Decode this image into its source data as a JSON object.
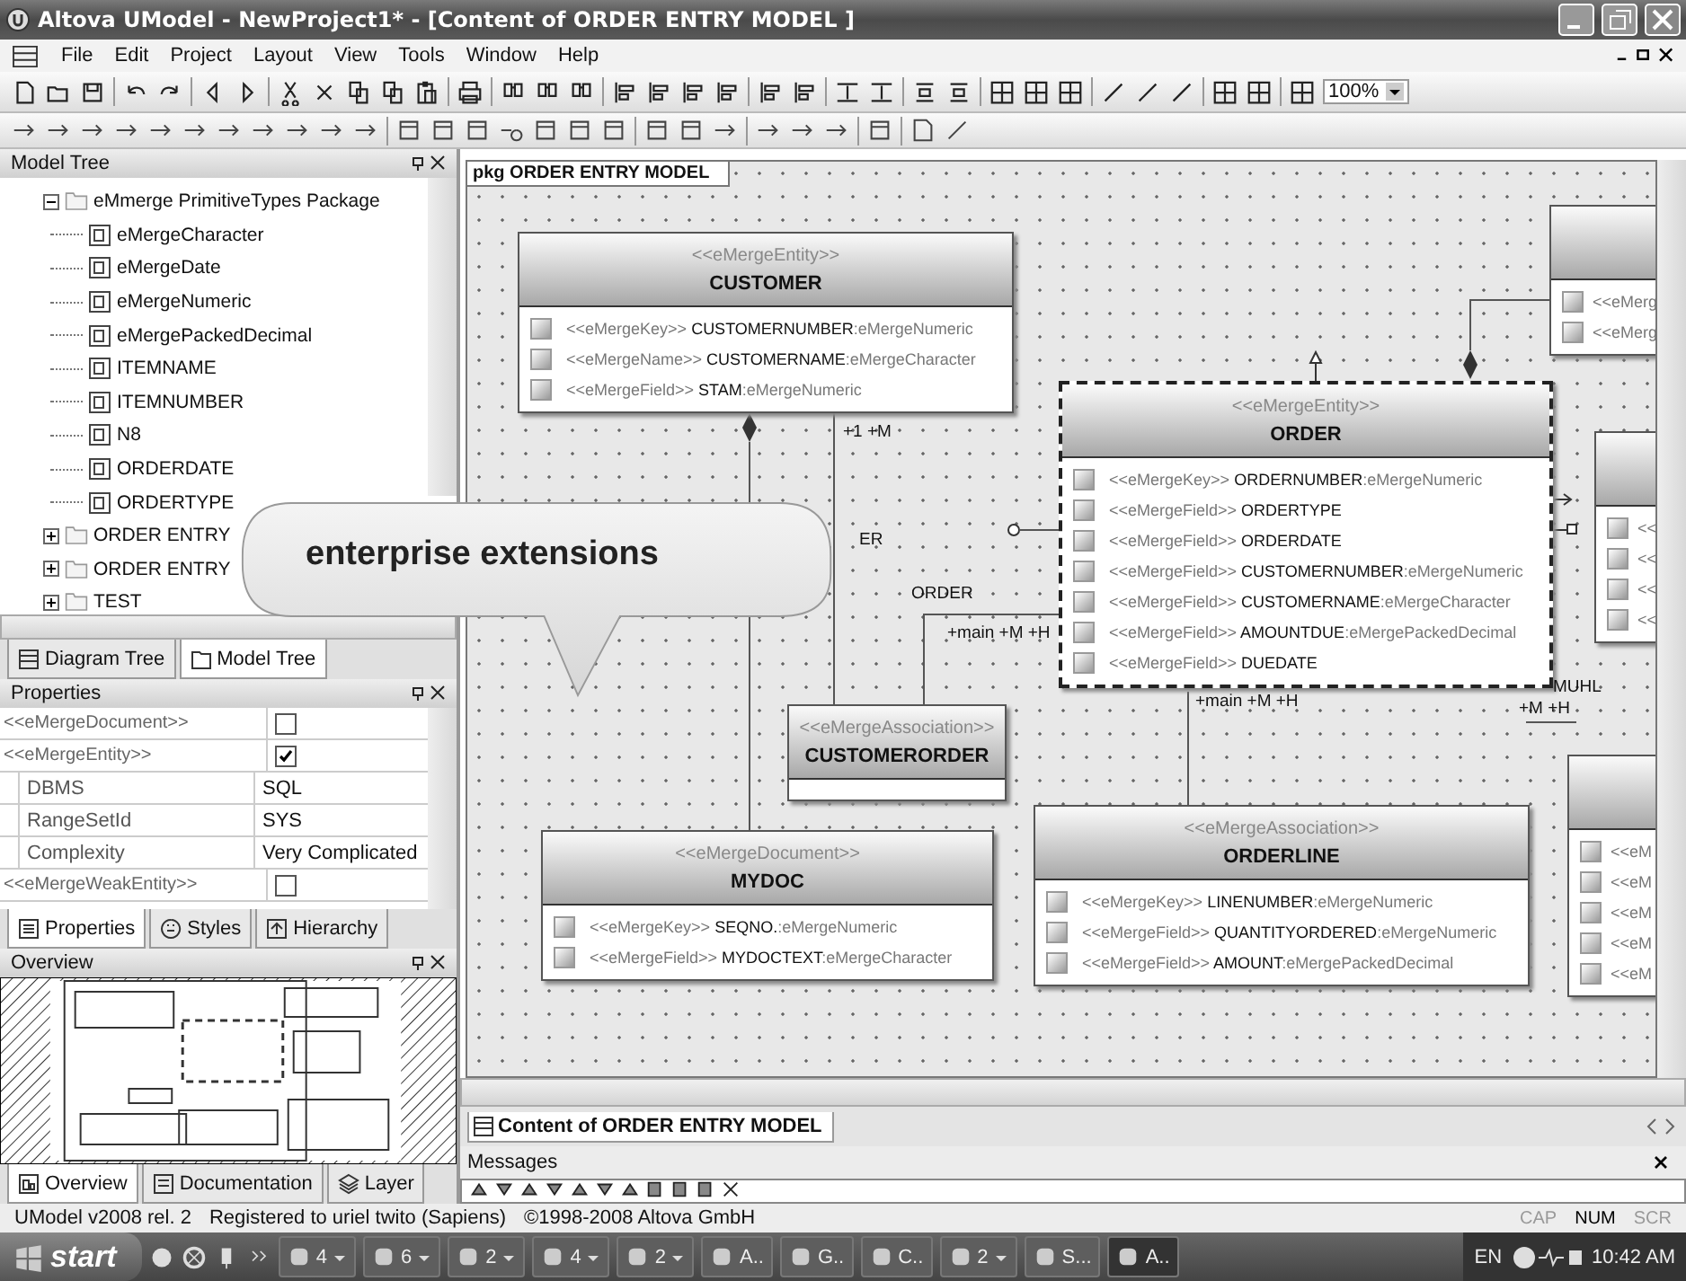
{
  "window": {
    "title": "Altova UModel - NewProject1* - [Content of ORDER ENTRY MODEL ]"
  },
  "menu": [
    "File",
    "Edit",
    "Project",
    "Layout",
    "View",
    "Tools",
    "Window",
    "Help"
  ],
  "toolbar": {
    "zoom": "100%"
  },
  "model_tree": {
    "title": "Model Tree",
    "items": [
      {
        "label": "eMmerge PrimitiveTypes Package",
        "kind": "package",
        "expanded": true,
        "children": [
          {
            "label": "eMergeCharacter",
            "kind": "primitive"
          },
          {
            "label": "eMergeDate",
            "kind": "primitive"
          },
          {
            "label": "eMergeNumeric",
            "kind": "primitive"
          },
          {
            "label": "eMergePackedDecimal",
            "kind": "primitive"
          },
          {
            "label": "ITEMNAME",
            "kind": "primitive"
          },
          {
            "label": "ITEMNUMBER",
            "kind": "primitive"
          },
          {
            "label": "N8",
            "kind": "primitive"
          },
          {
            "label": "ORDERDATE",
            "kind": "primitive"
          },
          {
            "label": "ORDERTYPE",
            "kind": "primitive"
          }
        ]
      },
      {
        "label": "ORDER ENTRY",
        "kind": "package",
        "expanded": false
      },
      {
        "label": "ORDER ENTRY",
        "kind": "package",
        "expanded": false
      },
      {
        "label": "TEST",
        "kind": "package",
        "expanded": false
      }
    ]
  },
  "tree_tabs": [
    {
      "label": "Diagram Tree",
      "selected": false
    },
    {
      "label": "Model Tree",
      "selected": true
    }
  ],
  "properties": {
    "title": "Properties",
    "rows": [
      {
        "name": "<<eMergeDocument>>",
        "kind": "checkbox",
        "checked": false
      },
      {
        "name": "<<eMergeEntity>>",
        "kind": "checkbox",
        "checked": true,
        "children": [
          {
            "name": "DBMS",
            "kind": "text",
            "value": "SQL"
          },
          {
            "name": "RangeSetId",
            "kind": "text",
            "value": "SYS"
          },
          {
            "name": "Complexity",
            "kind": "text",
            "value": "Very Complicated"
          }
        ]
      },
      {
        "name": "<<eMergeWeakEntity>>",
        "kind": "checkbox",
        "checked": false
      }
    ]
  },
  "properties_tabs": [
    {
      "label": "Properties",
      "selected": true
    },
    {
      "label": "Styles",
      "selected": false
    },
    {
      "label": "Hierarchy",
      "selected": false
    }
  ],
  "overview": {
    "title": "Overview"
  },
  "overview_tabs": [
    {
      "label": "Overview",
      "selected": true
    },
    {
      "label": "Documentation",
      "selected": false
    },
    {
      "label": "Layer",
      "selected": false
    }
  ],
  "diagram": {
    "frame_label": "pkg ORDER ENTRY MODEL",
    "classes": [
      {
        "stereotype": "<<eMergeEntity>>",
        "name": "CUSTOMER",
        "selected": false,
        "attributes": [
          {
            "stereotype": "<<eMergeKey>>",
            "name": "CUSTOMERNUMBER",
            "type": ":eMergeNumeric"
          },
          {
            "stereotype": "<<eMergeName>>",
            "name": "CUSTOMERNAME",
            "type": ":eMergeCharacter"
          },
          {
            "stereotype": "<<eMergeField>>",
            "name": "STAM",
            "type": ":eMergeNumeric"
          }
        ]
      },
      {
        "stereotype": "<<eMergeEntity>>",
        "name": "ORDER",
        "selected": true,
        "attributes": [
          {
            "stereotype": "<<eMergeKey>>",
            "name": "ORDERNUMBER",
            "type": ":eMergeNumeric"
          },
          {
            "stereotype": "<<eMergeField>>",
            "name": "ORDERTYPE"
          },
          {
            "stereotype": "<<eMergeField>>",
            "name": "ORDERDATE"
          },
          {
            "stereotype": "<<eMergeField>>",
            "name": "CUSTOMERNUMBER",
            "type": ":eMergeNumeric"
          },
          {
            "stereotype": "<<eMergeField>>",
            "name": "CUSTOMERNAME",
            "type": ":eMergeCharacter"
          },
          {
            "stereotype": "<<eMergeField>>",
            "name": "AMOUNTDUE",
            "type": ":eMergePackedDecimal"
          },
          {
            "stereotype": "<<eMergeField>>",
            "name": "DUEDATE"
          }
        ]
      },
      {
        "stereotype": "<<eMergeAssociation>>",
        "name": "CUSTOMERORDER",
        "selected": false
      },
      {
        "stereotype": "<<eMergeDocument>>",
        "name": "MYDOC",
        "selected": false,
        "attributes": [
          {
            "stereotype": "<<eMergeKey>>",
            "name": "SEQNO.",
            "type": ":eMergeNumeric"
          },
          {
            "stereotype": "<<eMergeField>>",
            "name": "MYDOCTEXT",
            "type": ":eMergeCharacter"
          }
        ]
      },
      {
        "stereotype": "<<eMergeAssociation>>",
        "name": "ORDERLINE",
        "selected": false,
        "attributes": [
          {
            "stereotype": "<<eMergeKey>>",
            "name": "LINENUMBER",
            "type": ":eMergeNumeric"
          },
          {
            "stereotype": "<<eMergeField>>",
            "name": "QUANTITYORDERED",
            "type": ":eMergeNumeric"
          },
          {
            "stereotype": "<<eMergeField>>",
            "name": "AMOUNT",
            "type": ":eMergePackedDecimal"
          }
        ]
      }
    ],
    "partial_classes": [
      {
        "rows": [
          "<<eMerg",
          "<<eMerg"
        ]
      },
      {
        "rows": [
          "<<",
          "<<",
          "<<",
          "<<"
        ]
      },
      {
        "rows": [
          "<<eM",
          "<<eM",
          "<<eM",
          "<<eM",
          "<<eM"
        ]
      }
    ],
    "labels": [
      "+1 +M",
      "ER",
      "ORDER",
      "+main +M +H",
      "+main +M +H",
      "+M +H",
      "MUHL"
    ]
  },
  "callout": "enterprise extensions",
  "document_tab": "Content of ORDER ENTRY MODEL",
  "messages": {
    "title": "Messages"
  },
  "status_bar": {
    "texts": [
      "UModel v2008 rel. 2",
      "Registered to uriel twito (Sapiens)",
      "©1998-2008 Altova GmbH"
    ],
    "indicators": [
      {
        "label": "CAP",
        "on": false
      },
      {
        "label": "NUM",
        "on": true
      },
      {
        "label": "SCR",
        "on": false
      }
    ]
  },
  "taskbar": {
    "start": "start",
    "tasks": [
      {
        "label": "4",
        "grouped": true,
        "selected": false
      },
      {
        "label": "6",
        "grouped": true,
        "selected": false
      },
      {
        "label": "2",
        "grouped": true,
        "selected": false
      },
      {
        "label": "4",
        "grouped": true,
        "selected": false
      },
      {
        "label": "2",
        "grouped": true,
        "selected": false
      },
      {
        "label": "A..",
        "grouped": false,
        "selected": false
      },
      {
        "label": "G..",
        "grouped": false,
        "selected": false
      },
      {
        "label": "C..",
        "grouped": false,
        "selected": false
      },
      {
        "label": "2",
        "grouped": true,
        "selected": false
      },
      {
        "label": "S...",
        "grouped": false,
        "selected": false
      },
      {
        "label": "A..",
        "grouped": false,
        "selected": true
      }
    ],
    "language": "EN",
    "clock": "10:42 AM"
  }
}
